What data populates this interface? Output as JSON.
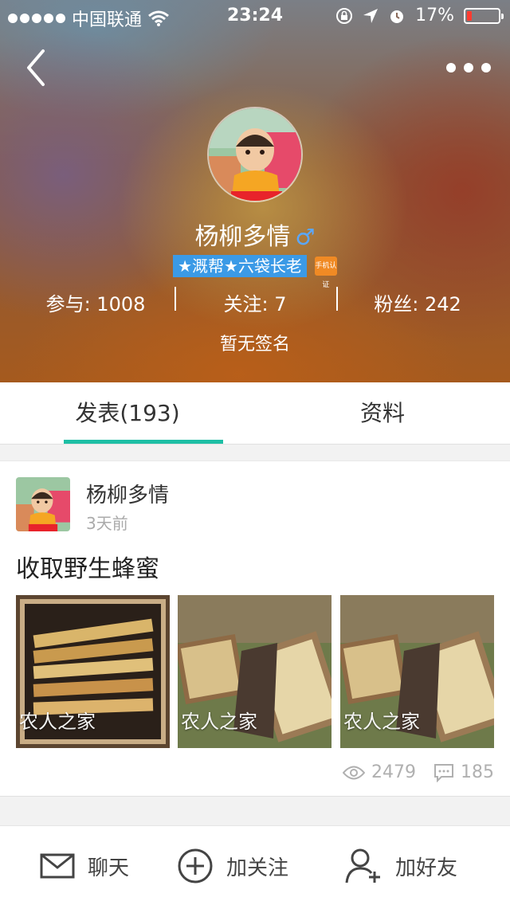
{
  "status_bar": {
    "carrier": "中国联通",
    "time": "23:24",
    "battery_percent": "17%",
    "battery_level": 0.17
  },
  "profile": {
    "name": "杨柳多情",
    "gender_symbol": "♂",
    "title_badge": "★溉帮★六袋长老",
    "auth_icon_label": "手机认证",
    "stats": {
      "participate": "参与: 1008",
      "follow": "关注: 7",
      "fans": "粉丝: 242"
    },
    "signature": "暂无签名"
  },
  "tabs": {
    "posts": "发表(193)",
    "profile": "资料"
  },
  "post": {
    "author": "杨柳多情",
    "time": "3天前",
    "title": "收取野生蜂蜜",
    "watermark": "农人之家",
    "views": "2479",
    "comments": "185"
  },
  "actions": {
    "chat": "聊天",
    "follow": "加关注",
    "add_friend": "加好友"
  },
  "colors": {
    "accent": "#1ebfa5",
    "badge": "#3b9ae6",
    "gender": "#5aa8ff",
    "battery": "#ff3b30"
  }
}
